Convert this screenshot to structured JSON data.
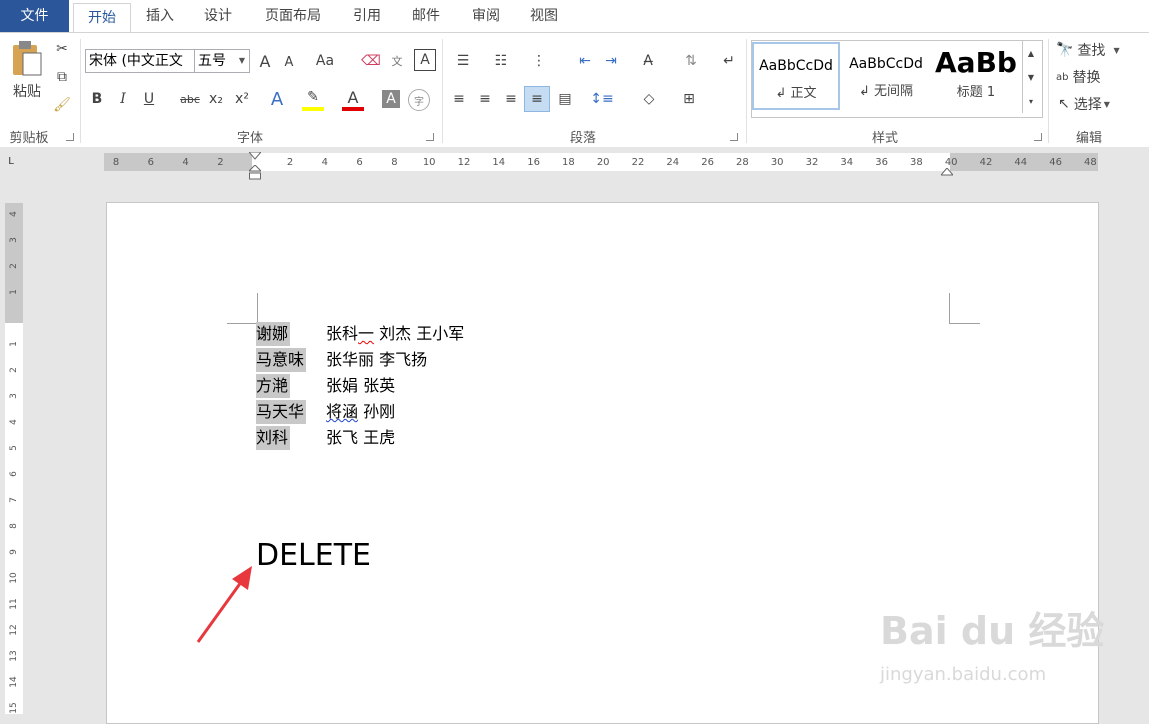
{
  "tabs": {
    "file": "文件",
    "home": "开始",
    "insert": "插入",
    "design": "设计",
    "layout": "页面布局",
    "references": "引用",
    "mailings": "邮件",
    "review": "审阅",
    "view": "视图"
  },
  "clipboard": {
    "paste": "粘贴",
    "group": "剪贴板"
  },
  "font": {
    "name": "宋体 (中文正文",
    "size": "五号",
    "group": "字体",
    "grow": "A",
    "shrink": "A",
    "case": "Aa",
    "bold": "B",
    "italic": "I",
    "underline": "U",
    "strike": "abc",
    "sub": "x₂",
    "sup": "x²"
  },
  "paragraph": {
    "group": "段落"
  },
  "styles": {
    "group": "样式",
    "items": [
      {
        "preview": "AaBbCcDd",
        "name": "↲ 正文"
      },
      {
        "preview": "AaBbCcDd",
        "name": "↲ 无间隔"
      },
      {
        "preview": "AaBb",
        "name": "标题 1"
      }
    ]
  },
  "editing": {
    "group": "编辑",
    "find": "查找",
    "replace": "替换",
    "select": "选择"
  },
  "ruler": {
    "corner": "L",
    "hticks": [
      "8",
      "6",
      "4",
      "2",
      "",
      "2",
      "4",
      "6",
      "8",
      "10",
      "12",
      "14",
      "16",
      "18",
      "20",
      "22",
      "24",
      "26",
      "28",
      "30",
      "32",
      "34",
      "36",
      "38",
      "40",
      "42",
      "44",
      "46",
      "48"
    ],
    "vticks": [
      "4",
      "3",
      "2",
      "1",
      "",
      "1",
      "2",
      "3",
      "4",
      "5",
      "6",
      "7",
      "8",
      "9",
      "10",
      "11",
      "12",
      "13",
      "14",
      "15"
    ]
  },
  "document": {
    "rows": [
      {
        "name": "谢娜",
        "rest_plain": "张科",
        "rest_red": "一",
        "rest_after": " 刘杰  王小军"
      },
      {
        "name": "马意味",
        "rest_plain": "张华丽  李飞扬",
        "rest_red": "",
        "rest_after": ""
      },
      {
        "name": "方滟",
        "rest_plain": "张娟  张英",
        "rest_red": "",
        "rest_after": ""
      },
      {
        "name": "马天华",
        "rest_plain": "",
        "rest_blue": "将涵",
        "rest_after": " 孙刚"
      },
      {
        "name": "刘科",
        "rest_plain": "张飞  王虎",
        "rest_red": "",
        "rest_after": ""
      }
    ],
    "annotation": "DELETE"
  },
  "watermark": {
    "main": "Bai du 经验",
    "sub": "jingyan.baidu.com"
  },
  "colors": {
    "accent": "#2b579a",
    "annotation_arrow": "#e8383d"
  }
}
